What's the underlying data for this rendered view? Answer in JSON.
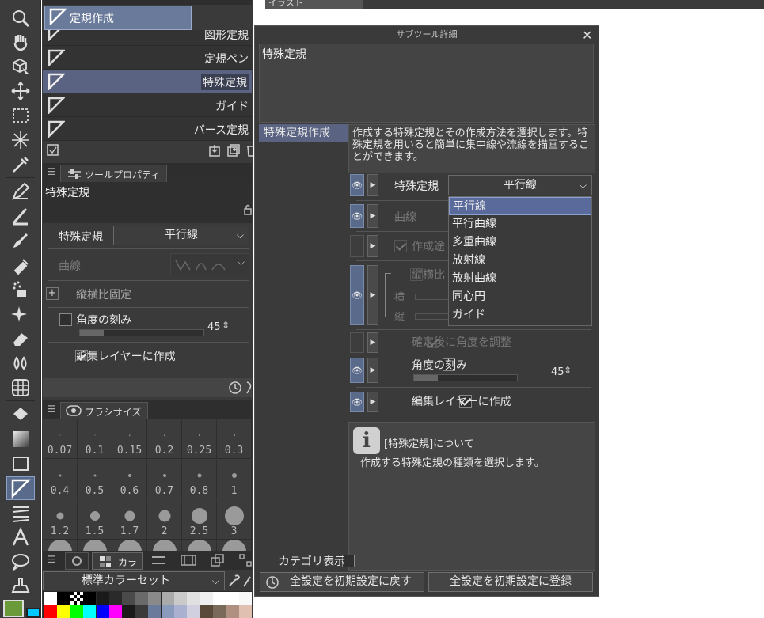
{
  "top_strip": {
    "menu_label": "イラスト"
  },
  "subtool_list": {
    "items": [
      {
        "label": "定規作成",
        "selected": false
      },
      {
        "label": "図形定規",
        "selected": false
      },
      {
        "label": "定規ペン",
        "selected": false
      },
      {
        "label": "特殊定規",
        "selected": true
      },
      {
        "label": "ガイド",
        "selected": false
      },
      {
        "label": "パース定規",
        "selected": false
      }
    ]
  },
  "tool_property": {
    "tab_label": "ツールプロパティ",
    "tool_name": "特殊定規",
    "special_ruler_label": "特殊定規",
    "special_ruler_value": "平行線",
    "curve_label": "曲線",
    "aspect_lock_label": "縦横比固定",
    "angle_step_label": "角度の刻み",
    "angle_step_value": "45",
    "create_on_layer_label": "編集レイヤーに作成"
  },
  "brush_size": {
    "tab_label": "ブラシサイズ",
    "sizes": [
      "0.07",
      "0.1",
      "0.15",
      "0.2",
      "0.25",
      "0.3",
      "0.4",
      "0.5",
      "0.6",
      "0.7",
      "0.8",
      "1",
      "1.2",
      "1.5",
      "1.7",
      "2",
      "2.5",
      "3"
    ]
  },
  "color_set": {
    "tab_label": "カラ",
    "set_name": "標準カラーセット"
  },
  "dialog": {
    "title": "サブツール詳細",
    "tool_name": "特殊定規",
    "category": "特殊定規作成",
    "description": "作成する特殊定規とその作成方法を選択します。特殊定規を用いると簡単に集中線や流線を描画することができます。",
    "special_ruler_label": "特殊定規",
    "special_ruler_value": "平行線",
    "curve_label": "曲線",
    "during_create_label": "作成途",
    "aspect_label": "縦横比",
    "width_label": "横",
    "height_label": "縦",
    "adjust_after_label": "確定後に角度を調整",
    "angle_step_label": "角度の刻み",
    "angle_step_value": "45",
    "create_on_layer_label": "編集レイヤーに作成",
    "info_title": "[特殊定規]について",
    "info_text": "作成する特殊定規の種類を選択します。",
    "show_category_label": "カテゴリ表示",
    "reset_all_label": "全設定を初期設定に戻す",
    "register_all_label": "全設定を初期設定に登録",
    "dropdown_options": [
      "平行線",
      "平行曲線",
      "多重曲線",
      "放射線",
      "放射曲線",
      "同心円",
      "ガイド"
    ],
    "dropdown_selected": "平行線"
  },
  "colors": {
    "accent": "#5a6a8a",
    "panel": "#3a3a3a",
    "main_color": "#6a9a3a",
    "sub_color": "#00c8ff"
  }
}
